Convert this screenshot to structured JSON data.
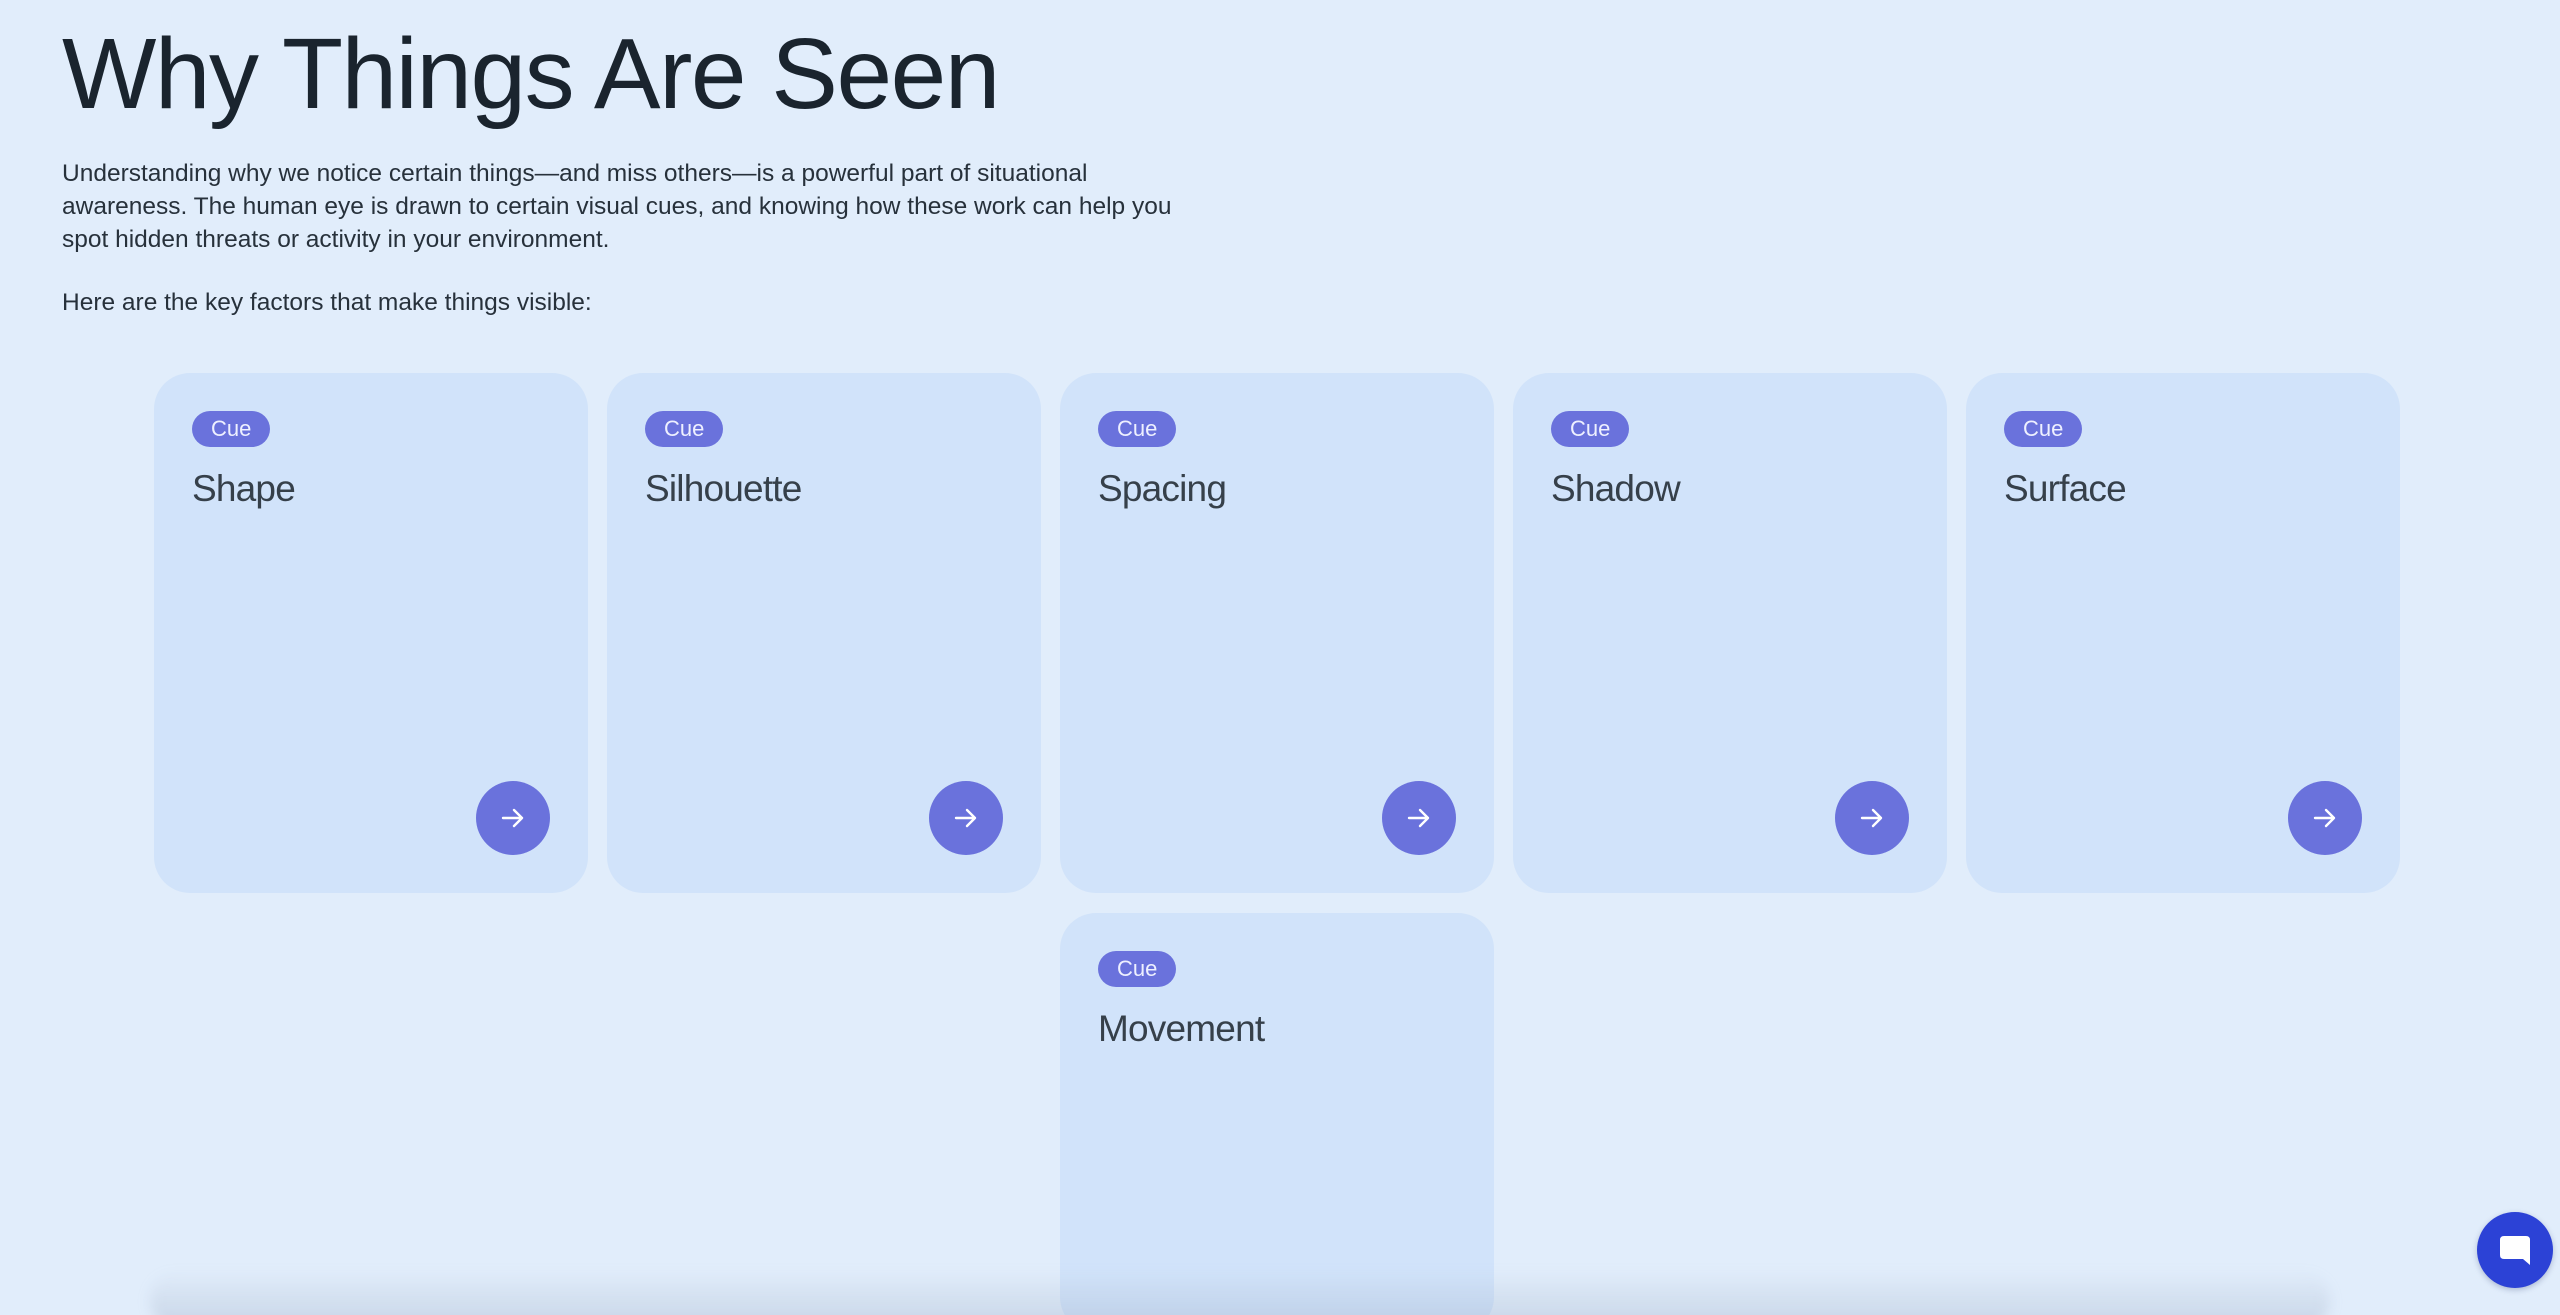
{
  "page": {
    "title": "Why Things Are Seen",
    "intro": "Understanding why we notice certain things—and miss others—is a powerful part of situational awareness. The human eye is drawn to certain visual cues, and knowing how these work can help you spot hidden threats or activity in your environment.",
    "lead": "Here are the key factors that make things visible:"
  },
  "cards": [
    {
      "badge": "Cue",
      "title": "Shape"
    },
    {
      "badge": "Cue",
      "title": "Silhouette"
    },
    {
      "badge": "Cue",
      "title": "Spacing"
    },
    {
      "badge": "Cue",
      "title": "Shadow"
    },
    {
      "badge": "Cue",
      "title": "Surface"
    },
    {
      "badge": "Cue",
      "title": "Movement"
    }
  ],
  "icons": {
    "card_action": "arrow-right-icon",
    "chat": "chat-bubble-icon"
  },
  "colors": {
    "background": "#e1edfb",
    "card": "#d1e3fa",
    "accent": "#6a72dc",
    "chat": "#2c42d6"
  }
}
